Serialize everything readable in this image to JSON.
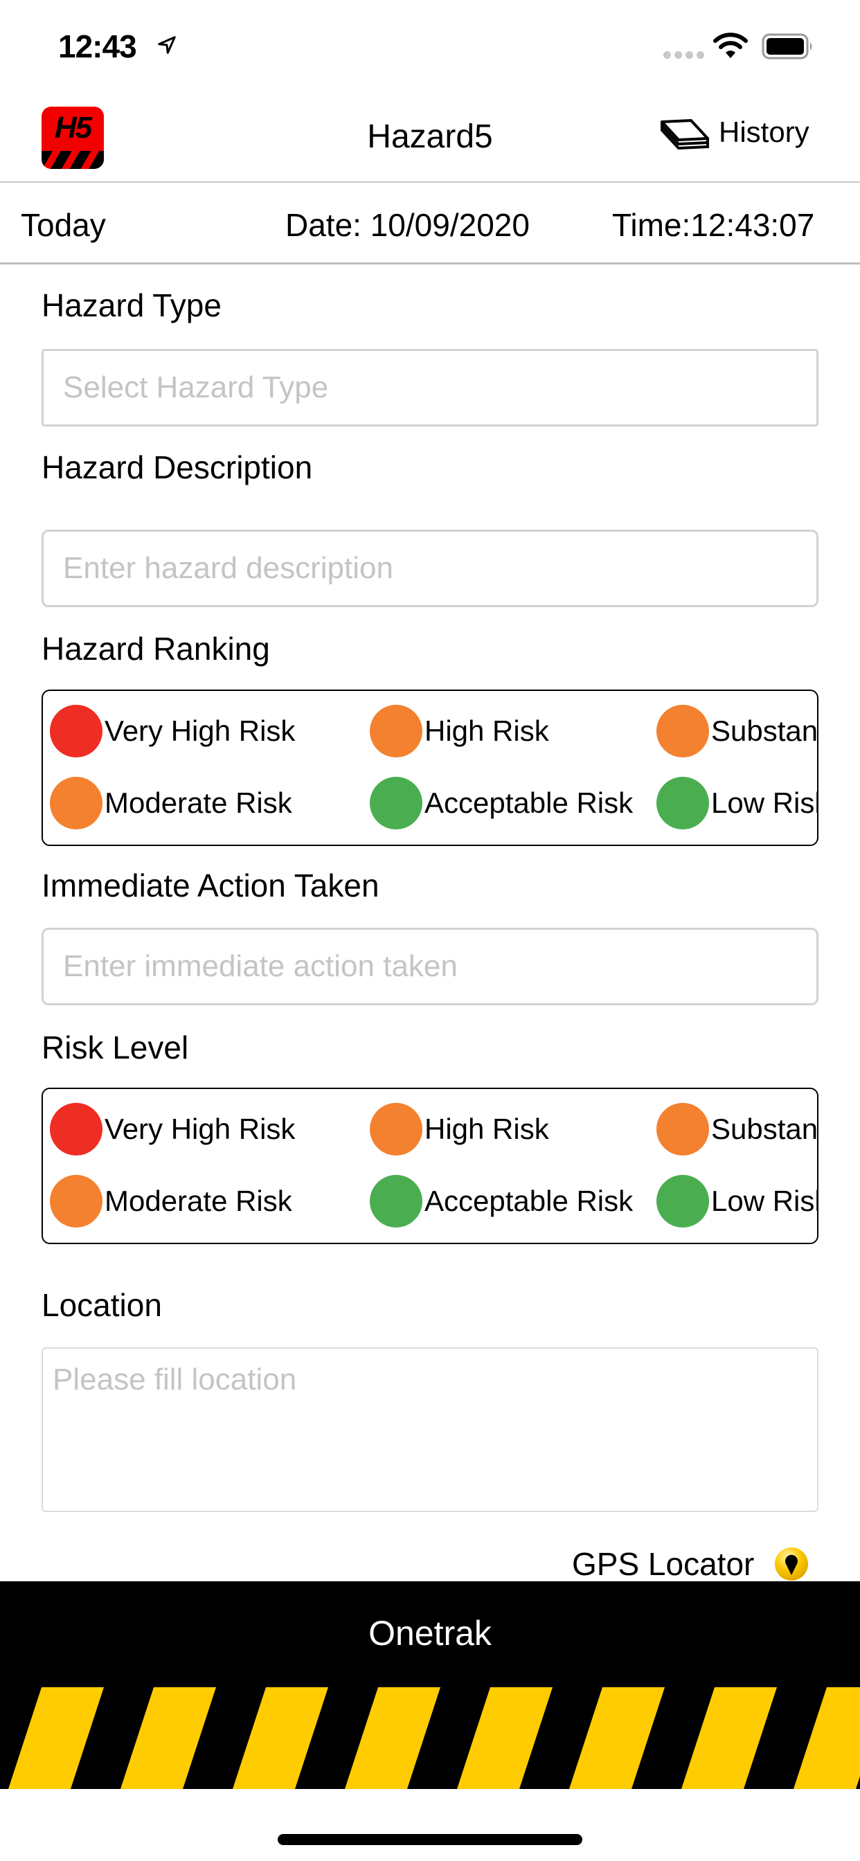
{
  "status_bar": {
    "time": "12:43",
    "icons": [
      "location-arrow-icon",
      "cellular-signal-icon",
      "wifi-icon",
      "battery-icon"
    ]
  },
  "header": {
    "logo_text": "H5",
    "title": "Hazard5",
    "history_label": "History",
    "history_icon": "book-stack-icon"
  },
  "date_row": {
    "today_label": "Today",
    "date": "Date: 10/09/2020",
    "time": "Time:12:43:07"
  },
  "form": {
    "hazard_type": {
      "label": "Hazard Type",
      "placeholder": "Select Hazard Type"
    },
    "hazard_description": {
      "label": "Hazard Description",
      "placeholder": "Enter hazard description"
    },
    "hazard_ranking": {
      "label": "Hazard Ranking",
      "options": [
        {
          "label": "Very High Risk",
          "color": "#ee2d24"
        },
        {
          "label": "High Risk",
          "color": "#f4812f"
        },
        {
          "label": "Substantial Risk",
          "color": "#f4812f"
        },
        {
          "label": "Moderate Risk",
          "color": "#f4812f"
        },
        {
          "label": "Acceptable Risk",
          "color": "#4aae50"
        },
        {
          "label": "Low Risk",
          "color": "#4aae50"
        }
      ]
    },
    "immediate_action": {
      "label": "Immediate Action Taken",
      "placeholder": "Enter immediate action taken"
    },
    "risk_level": {
      "label": "Risk Level",
      "options": [
        {
          "label": "Very High Risk",
          "color": "#ee2d24"
        },
        {
          "label": "High Risk",
          "color": "#f4812f"
        },
        {
          "label": "Substantial Risk",
          "color": "#f4812f"
        },
        {
          "label": "Moderate Risk",
          "color": "#f4812f"
        },
        {
          "label": "Acceptable Risk",
          "color": "#4aae50"
        },
        {
          "label": "Low Risk",
          "color": "#4aae50"
        }
      ]
    },
    "location": {
      "label": "Location",
      "placeholder": "Please fill location"
    },
    "gps_locator": {
      "label": "GPS Locator",
      "icon": "map-pin-icon"
    }
  },
  "footer": {
    "title": "Onetrak",
    "stripe_colors": [
      "#000000",
      "#fecc00"
    ]
  }
}
